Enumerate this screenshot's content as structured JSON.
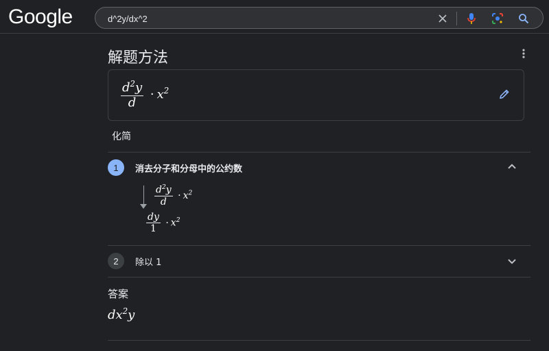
{
  "header": {
    "logo": "Google",
    "search_value": "d^2y/dx^2",
    "icons": [
      "clear-icon",
      "mic-icon",
      "lens-icon",
      "search-icon"
    ]
  },
  "card": {
    "title": "解题方法",
    "problem": {
      "num_base": "d",
      "num_exp": "2",
      "num_var": "y",
      "den": "d",
      "dot": "·",
      "x": "x",
      "x_exp": "2"
    },
    "method": "化简"
  },
  "steps": [
    {
      "number": "1",
      "label": "消去分子和分母中的公约数",
      "before": {
        "num_base": "d",
        "num_exp": "2",
        "num_var": "y",
        "den": "d",
        "dot": "·",
        "x": "x",
        "x_exp": "2"
      },
      "after": {
        "num_base": "d",
        "num_var": "y",
        "den": "1",
        "dot": "·",
        "x": "x",
        "x_exp": "2"
      }
    },
    {
      "number": "2",
      "label": "除以 1"
    }
  ],
  "answer": {
    "label": "答案",
    "d": "d",
    "x": "x",
    "x_exp": "2",
    "y": "y"
  },
  "colors": {
    "background": "#202124",
    "accent_blue": "#8ab4f8",
    "border": "#3c4043"
  }
}
